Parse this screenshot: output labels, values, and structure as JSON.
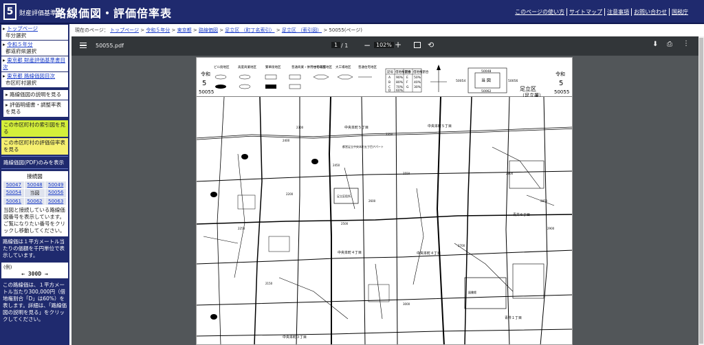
{
  "header": {
    "logo_number": "5",
    "subtitle": "財産評価基準書",
    "title": "路線価図・評価倍率表",
    "links": [
      "このページの使い方",
      "サイトマップ",
      "注意事項",
      "お問い合わせ",
      "国税庁"
    ]
  },
  "sidebar": {
    "items": [
      {
        "link": "トップページ",
        "sub": "年分選択"
      },
      {
        "link": "令和５年分",
        "sub": "都道府県選択"
      },
      {
        "link": "東京都 財産評価基準書目次",
        "sub": ""
      },
      {
        "link": "東京都 路線価図目次",
        "sub": "市区町村選択"
      }
    ],
    "btn_explain": "路線価図の説明を見る",
    "btn_detail": "評価明細書・調整率表を見る",
    "btn_index": "この市区町村の索引図を見る",
    "btn_rate": "この市区町村の評価倍率表を見る",
    "btn_pdf_only": "路線価図(PDF)のみを表示",
    "adjacent": {
      "title": "接続図",
      "cells": [
        "50047",
        "50048",
        "50049",
        "50054",
        "当図",
        "50056",
        "50061",
        "50062",
        "50063"
      ],
      "note": "当図と接続している路線価図番号を表示しています。ご覧になりたい番号をクリックし移動してください。"
    },
    "info1": "路線価は１平方メートル当たりの価額を千円単位で表示しています。",
    "example_label": "(例)",
    "example_value": "← 300D →",
    "info2": "この路線価は、１平方メートル当たり300,000円（借地権割合「D」は60%）を表します。詳細は、「路線価図の説明を見る」をクリックしてください。"
  },
  "breadcrumb": {
    "prefix": "現在のページ：",
    "links": [
      "トップページ",
      "令和５年分",
      "東京都",
      "路線価図",
      "足立区 （町丁名索引）",
      "足立区 （索引図）"
    ],
    "current": "50055(ページ)"
  },
  "viewer": {
    "filename": "50055.pdf",
    "page_current": "1",
    "page_total": "/ 1",
    "zoom": "102%"
  },
  "map": {
    "era": "令和",
    "year": "5",
    "sheet": "50055",
    "ward": "足立区",
    "office": "（足立署）",
    "current_cell": "当 図",
    "adj_top": "50048",
    "adj_left": "50054",
    "adj_right": "50056",
    "adj_bottom": "50062",
    "legend_labels": [
      "ビル街地区",
      "高度商業地区",
      "繁華街地区",
      "普通商業・併用住宅地区",
      "中小工場地区",
      "大工場地区",
      "普通住宅地区"
    ],
    "rate_table": [
      [
        "記号",
        "借地権割合",
        "記号",
        "借地権割合"
      ],
      [
        "A",
        "90%",
        "E",
        "50%"
      ],
      [
        "B",
        "80%",
        "F",
        "40%"
      ],
      [
        "C",
        "70%",
        "G",
        "30%"
      ],
      [
        "D",
        "60%",
        "",
        ""
      ]
    ],
    "labels": [
      "中央本町５丁目",
      "中央本町５丁目",
      "中央本町４丁目",
      "中央本町４丁目",
      "青井６丁目",
      "青井１丁目",
      "中央本町３丁目",
      "都営足立中央本町五丁目アパート",
      "足立区役所",
      "図書館"
    ],
    "prices": [
      "2300",
      "2350",
      "2400",
      "2450",
      "2500",
      "2550",
      "2600",
      "2700",
      "2800",
      "2850",
      "2900",
      "3000",
      "2200",
      "2250",
      "2150"
    ]
  }
}
